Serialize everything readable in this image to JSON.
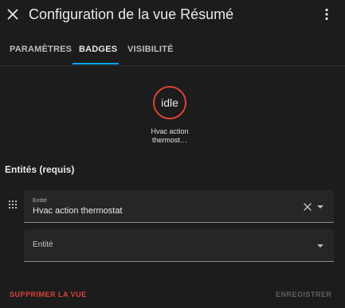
{
  "header": {
    "close_icon": "close-icon",
    "title": "Configuration de la vue Résumé",
    "more_icon": "more-vertical-icon"
  },
  "tabs": [
    {
      "label": "PARAMÈTRES",
      "active": false
    },
    {
      "label": "BADGES",
      "active": true
    },
    {
      "label": "VISIBILITÉ",
      "active": false
    }
  ],
  "colors": {
    "accent": "#03a9f4",
    "badge_border": "#db4437",
    "danger": "#db4437",
    "background": "#1c1c1c"
  },
  "badge": {
    "state": "idle",
    "name": "Hvac action thermost…"
  },
  "entities": {
    "title": "Entités (requis)",
    "drag_icon": "drag-handle-icon",
    "fields": [
      {
        "label": "Entité",
        "value": "Hvac action thermostat"
      },
      {
        "label": "Entité",
        "value": ""
      }
    ]
  },
  "footer": {
    "delete_label": "SUPPRIMER LA VUE",
    "save_label": "ENREGISTRER"
  }
}
